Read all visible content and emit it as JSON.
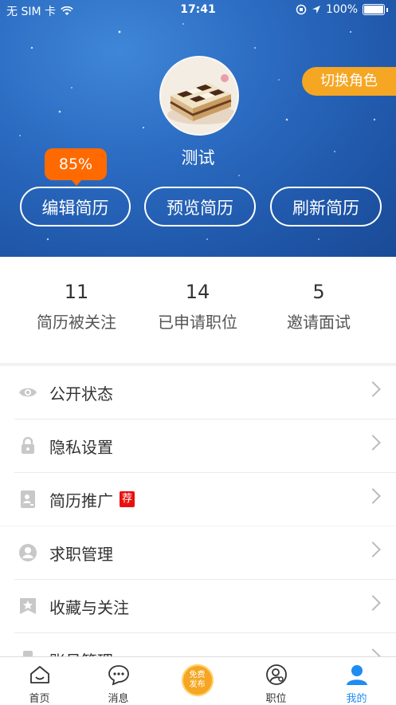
{
  "status_bar": {
    "carrier": "无 SIM 卡",
    "time": "17:41",
    "battery": "100%"
  },
  "profile": {
    "switch_role": "切换角色",
    "name": "测试",
    "completion": "85%",
    "buttons": [
      "编辑简历",
      "预览简历",
      "刷新简历"
    ]
  },
  "stats": [
    {
      "value": "11",
      "label": "简历被关注"
    },
    {
      "value": "14",
      "label": "已申请职位"
    },
    {
      "value": "5",
      "label": "邀请面试"
    }
  ],
  "menu_group_1": [
    {
      "label": "公开状态",
      "icon": "eye-icon"
    },
    {
      "label": "隐私设置",
      "icon": "lock-icon"
    },
    {
      "label": "简历推广",
      "icon": "resume-icon",
      "badge": "荐"
    }
  ],
  "menu_group_2": [
    {
      "label": "求职管理",
      "icon": "person-icon"
    },
    {
      "label": "收藏与关注",
      "icon": "star-bookmark-icon"
    },
    {
      "label": "账号管理",
      "icon": "account-icon"
    }
  ],
  "tabbar": {
    "items": [
      "首页",
      "消息",
      "职位",
      "我的"
    ],
    "publish": [
      "免费",
      "发布"
    ],
    "active_color": "#1e8cf0"
  },
  "colors": {
    "accent_orange": "#f5a623",
    "bubble_orange": "#ff6a00",
    "badge_red": "#e8110f",
    "hero_blue": "#2a6ac0"
  }
}
